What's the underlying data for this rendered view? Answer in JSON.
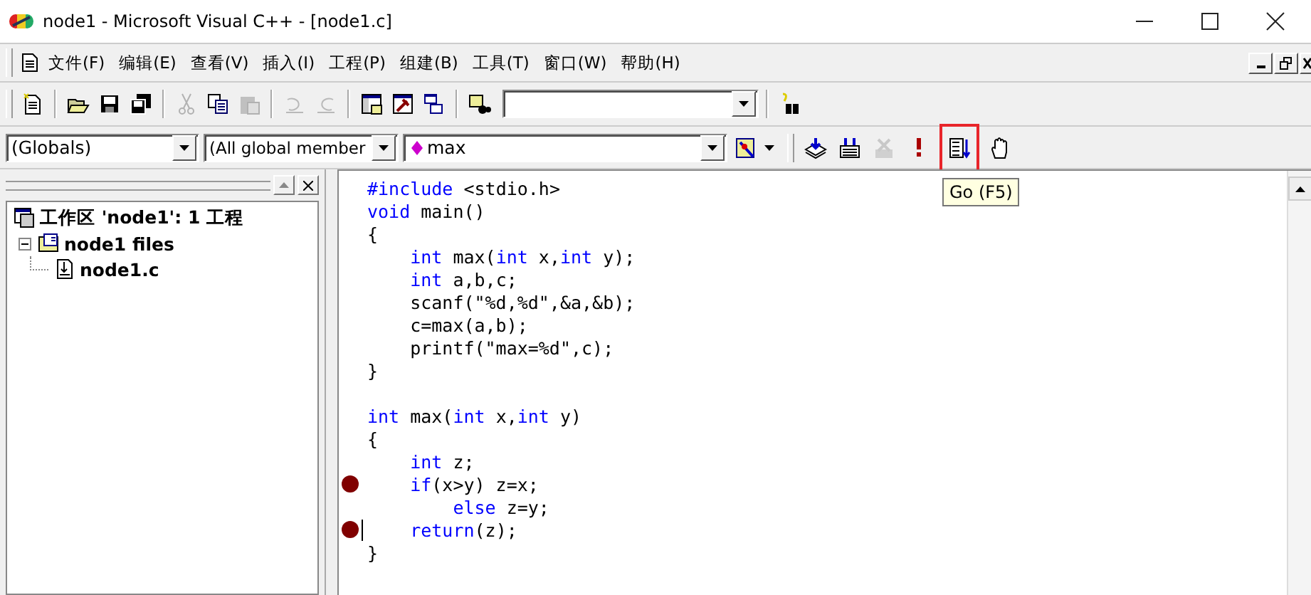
{
  "window": {
    "title": "node1 - Microsoft Visual C++ - [node1.c]"
  },
  "menu": [
    {
      "label": "文件(F)"
    },
    {
      "label": "编辑(E)"
    },
    {
      "label": "查看(V)"
    },
    {
      "label": "插入(I)"
    },
    {
      "label": "工程(P)"
    },
    {
      "label": "组建(B)"
    },
    {
      "label": "工具(T)"
    },
    {
      "label": "窗口(W)"
    },
    {
      "label": "帮助(H)"
    }
  ],
  "toolbar": [
    {
      "kind": "new-file",
      "disabled": false
    },
    {
      "kind": "sep"
    },
    {
      "kind": "open",
      "disabled": false
    },
    {
      "kind": "save",
      "disabled": false
    },
    {
      "kind": "save-all",
      "disabled": false
    },
    {
      "kind": "sep"
    },
    {
      "kind": "cut",
      "disabled": true
    },
    {
      "kind": "copy",
      "disabled": false
    },
    {
      "kind": "paste",
      "disabled": true
    },
    {
      "kind": "sep"
    },
    {
      "kind": "undo",
      "disabled": true
    },
    {
      "kind": "redo",
      "disabled": true
    },
    {
      "kind": "sep"
    },
    {
      "kind": "workspace",
      "disabled": false
    },
    {
      "kind": "output",
      "disabled": false
    },
    {
      "kind": "windows",
      "disabled": false
    },
    {
      "kind": "sep"
    },
    {
      "kind": "find-in-files",
      "disabled": false
    }
  ],
  "wizard": {
    "class_combo": "(Globals)",
    "filter_combo": "(All global member",
    "member_combo": "max"
  },
  "build_toolbar": [
    {
      "kind": "compile",
      "disabled": false,
      "highlighted": false
    },
    {
      "kind": "build",
      "disabled": false,
      "highlighted": false
    },
    {
      "kind": "stop",
      "disabled": true,
      "highlighted": false
    },
    {
      "kind": "execute",
      "disabled": false,
      "highlighted": false
    },
    {
      "kind": "go",
      "disabled": false,
      "highlighted": true
    },
    {
      "kind": "hand",
      "disabled": false,
      "highlighted": false
    }
  ],
  "tooltip": "Go (F5)",
  "workspace_tree": [
    {
      "label": "工作区 'node1': 1 工程",
      "kind": "workspace",
      "children": [
        {
          "label": "node1 files",
          "kind": "project",
          "expanded": true,
          "children": [
            {
              "label": "node1.c",
              "kind": "file"
            }
          ]
        }
      ]
    }
  ],
  "editor": {
    "lines": [
      {
        "breakpoint": false,
        "segments": [
          {
            "text": "#include",
            "kind": "keyword"
          },
          {
            "text": " <stdio.h>",
            "kind": "plain"
          }
        ]
      },
      {
        "breakpoint": false,
        "segments": [
          {
            "text": "void",
            "kind": "keyword"
          },
          {
            "text": " main()",
            "kind": "plain"
          }
        ]
      },
      {
        "breakpoint": false,
        "segments": [
          {
            "text": "{",
            "kind": "plain"
          }
        ]
      },
      {
        "breakpoint": false,
        "segments": [
          {
            "text": "    int",
            "kind": "keyword"
          },
          {
            "text": " max(",
            "kind": "plain"
          },
          {
            "text": "int",
            "kind": "keyword"
          },
          {
            "text": " x,",
            "kind": "plain"
          },
          {
            "text": "int",
            "kind": "keyword"
          },
          {
            "text": " y);",
            "kind": "plain"
          }
        ]
      },
      {
        "breakpoint": false,
        "segments": [
          {
            "text": "    int",
            "kind": "keyword"
          },
          {
            "text": " a,b,c;",
            "kind": "plain"
          }
        ]
      },
      {
        "breakpoint": false,
        "segments": [
          {
            "text": "    scanf(\"%d,%d\",&a,&b);",
            "kind": "plain"
          }
        ]
      },
      {
        "breakpoint": false,
        "segments": [
          {
            "text": "    c=max(a,b);",
            "kind": "plain"
          }
        ]
      },
      {
        "breakpoint": false,
        "segments": [
          {
            "text": "    printf(\"max=%d\",c);",
            "kind": "plain"
          }
        ]
      },
      {
        "breakpoint": false,
        "segments": [
          {
            "text": "}",
            "kind": "plain"
          }
        ]
      },
      {
        "breakpoint": false
      },
      {
        "breakpoint": false,
        "segments": [
          {
            "text": "int",
            "kind": "keyword"
          },
          {
            "text": " max(",
            "kind": "plain"
          },
          {
            "text": "int",
            "kind": "keyword"
          },
          {
            "text": " x,",
            "kind": "plain"
          },
          {
            "text": "int",
            "kind": "keyword"
          },
          {
            "text": " y)",
            "kind": "plain"
          }
        ]
      },
      {
        "breakpoint": false,
        "segments": [
          {
            "text": "{",
            "kind": "plain"
          }
        ]
      },
      {
        "breakpoint": false,
        "segments": [
          {
            "text": "    int",
            "kind": "keyword"
          },
          {
            "text": " z;",
            "kind": "plain"
          }
        ]
      },
      {
        "breakpoint": true,
        "segments": [
          {
            "text": "    if",
            "kind": "keyword"
          },
          {
            "text": "(x>y) z=x;",
            "kind": "plain"
          }
        ]
      },
      {
        "breakpoint": false,
        "segments": [
          {
            "text": "        else",
            "kind": "keyword"
          },
          {
            "text": " z=y;",
            "kind": "plain"
          }
        ]
      },
      {
        "breakpoint": true,
        "cursor": true,
        "segments": [
          {
            "text": "    return",
            "kind": "keyword"
          },
          {
            "text": "(z);",
            "kind": "plain"
          }
        ]
      },
      {
        "breakpoint": false,
        "segments": [
          {
            "text": "}",
            "kind": "plain"
          }
        ]
      }
    ]
  }
}
